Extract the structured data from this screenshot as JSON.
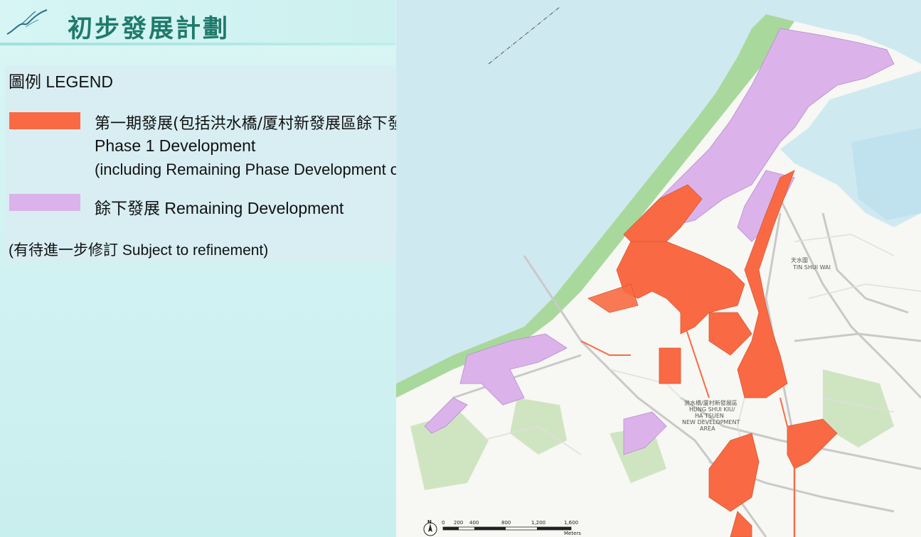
{
  "header": {
    "title": "初步發展計劃"
  },
  "legend": {
    "heading": "圖例 LEGEND",
    "items": [
      {
        "color": "#f96a44",
        "line1": "第一期發展(包括洪水橋/厦村新發展區餘下發展)",
        "line2": "Phase 1 Development",
        "line3": "(including Remaining Phase Development of HSK/HT NDA )"
      },
      {
        "color": "#dbb3ea",
        "line1": "餘下發展 Remaining Development"
      }
    ],
    "note": "(有待進一步修訂 Subject to refinement)"
  },
  "map": {
    "colors": {
      "sea": "#cfe9f1",
      "coast": "#a9d89c",
      "land": "#f7f7f3",
      "green": "#cfe5c2",
      "roads": "#c9c9c9",
      "phase1": "#f96a44",
      "remaining": "#dbb3ea"
    },
    "labels": {
      "tin_shui_wai_cn": "天水圍",
      "tin_shui_wai_en": "TIN SHUI WAI",
      "hsk_cn": "洪水橋/厦村新發展區",
      "hsk_en1": "HUNG SHUI KIU/",
      "hsk_en2": "HA TSUEN",
      "hsk_en3": "NEW DEVELOPMENT",
      "hsk_en4": "AREA"
    },
    "north_arrow": "N",
    "scale": {
      "ticks": [
        "0",
        "200",
        "400",
        "800",
        "1,200",
        "1,600"
      ],
      "unit": "Meters"
    }
  }
}
